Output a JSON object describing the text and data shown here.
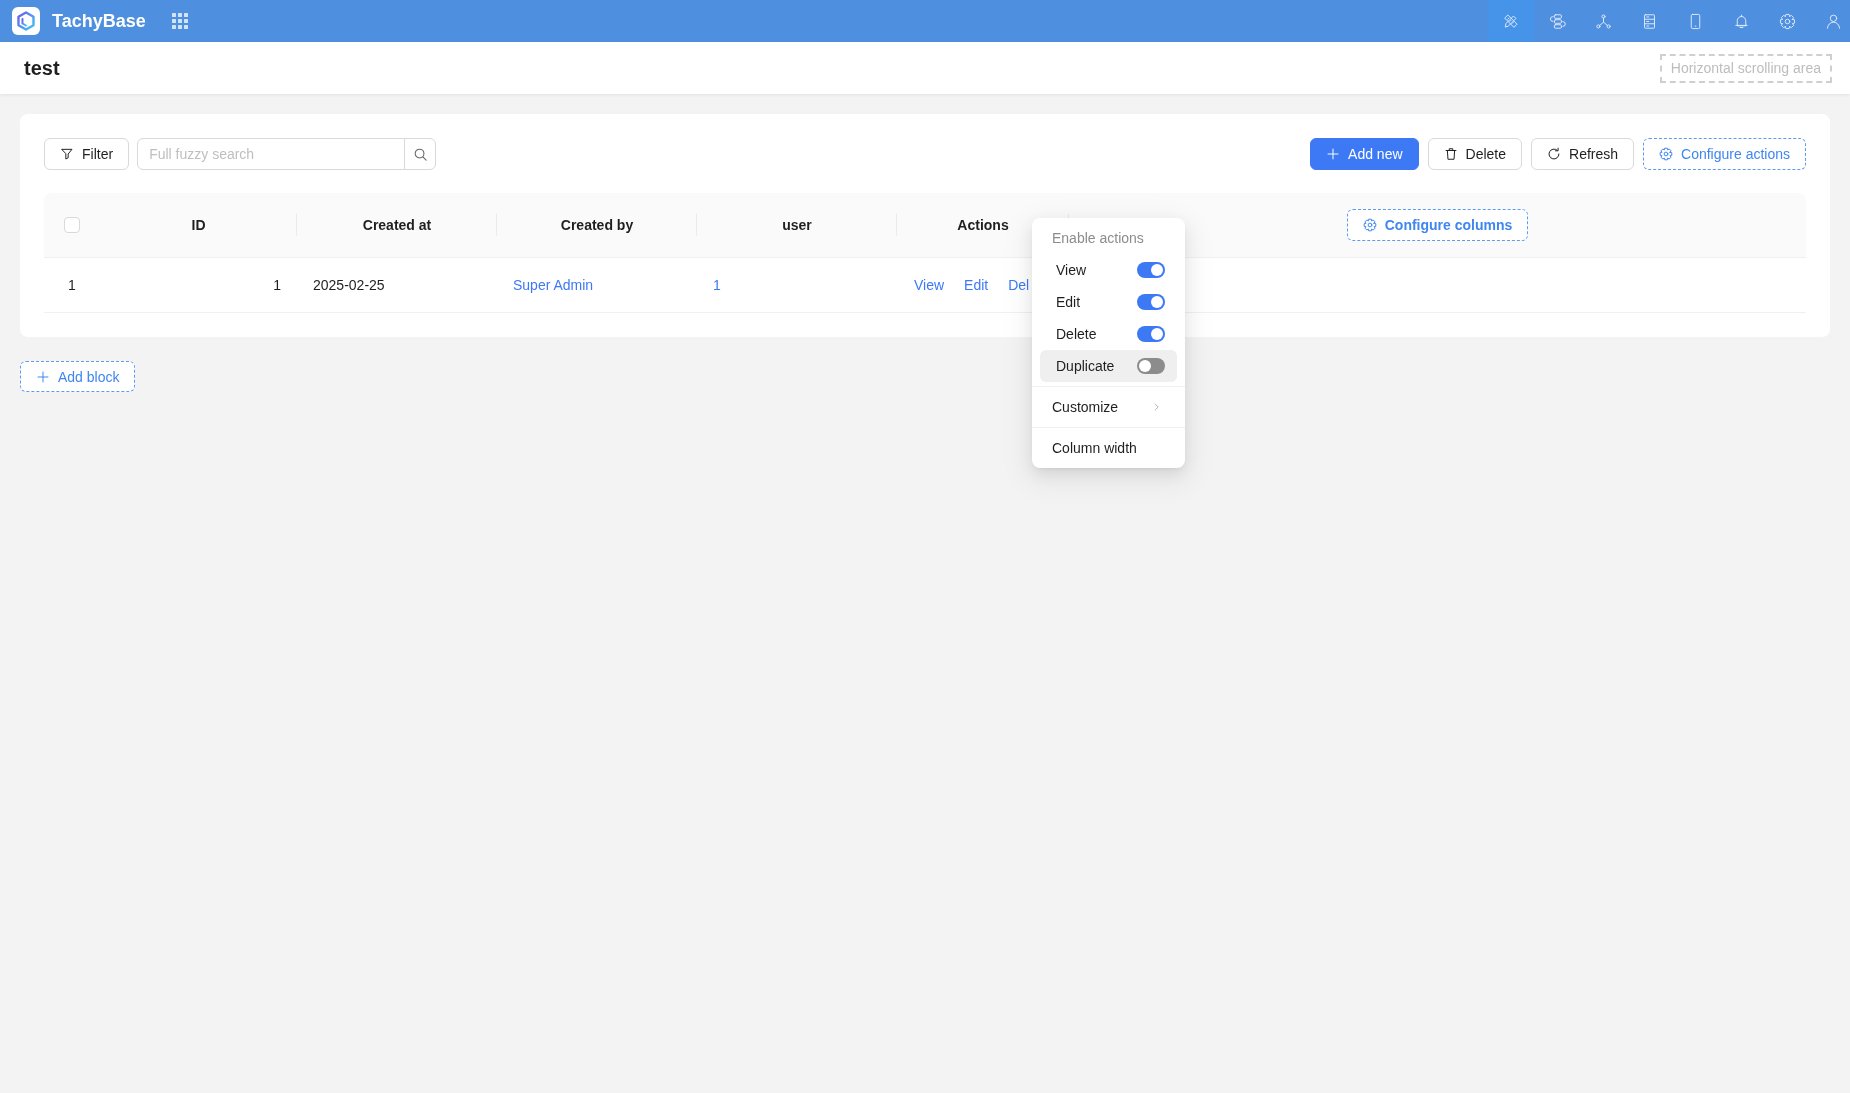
{
  "header": {
    "app_name": "TachyBase",
    "tools": [
      {
        "selected": true
      },
      {
        "selected": false
      },
      {
        "selected": false
      },
      {
        "selected": false
      },
      {
        "selected": false
      },
      {
        "selected": false
      },
      {
        "selected": false
      },
      {
        "selected": false
      }
    ]
  },
  "page": {
    "title": "test",
    "scroll_area_label": "Horizontal scrolling area"
  },
  "toolbar": {
    "filter_label": "Filter",
    "search": {
      "placeholder": "Full fuzzy search"
    },
    "actions": [
      {
        "kind": "add",
        "label": "Add new"
      },
      {
        "kind": "delete",
        "label": "Delete"
      },
      {
        "kind": "refresh",
        "label": "Refresh"
      },
      {
        "kind": "configure",
        "label": "Configure actions"
      }
    ]
  },
  "table": {
    "select_all": {
      "checked": false
    },
    "columns": [
      "ID",
      "Created at",
      "Created by",
      "user",
      "Actions"
    ],
    "configure_columns_label": "Configure columns",
    "rows": [
      {
        "number": "1",
        "cells": [
          {
            "kind": "number",
            "text": "1"
          },
          {
            "kind": "text",
            "text": "2025-02-25"
          },
          {
            "kind": "link",
            "text": "Super Admin"
          },
          {
            "kind": "link",
            "text": "1"
          }
        ],
        "actions": [
          "View",
          "Edit",
          "Del"
        ]
      }
    ]
  },
  "column_menu": {
    "group_title": "Enable actions",
    "toggles": [
      {
        "label": "View",
        "on": true,
        "highlighted": false
      },
      {
        "label": "Edit",
        "on": true,
        "highlighted": false
      },
      {
        "label": "Delete",
        "on": true,
        "highlighted": false
      },
      {
        "label": "Duplicate",
        "on": false,
        "highlighted": true
      }
    ],
    "items": [
      {
        "label": "Customize",
        "submenu": true
      },
      {
        "label": "Column width",
        "submenu": false
      }
    ]
  },
  "add_block_label": "Add block"
}
